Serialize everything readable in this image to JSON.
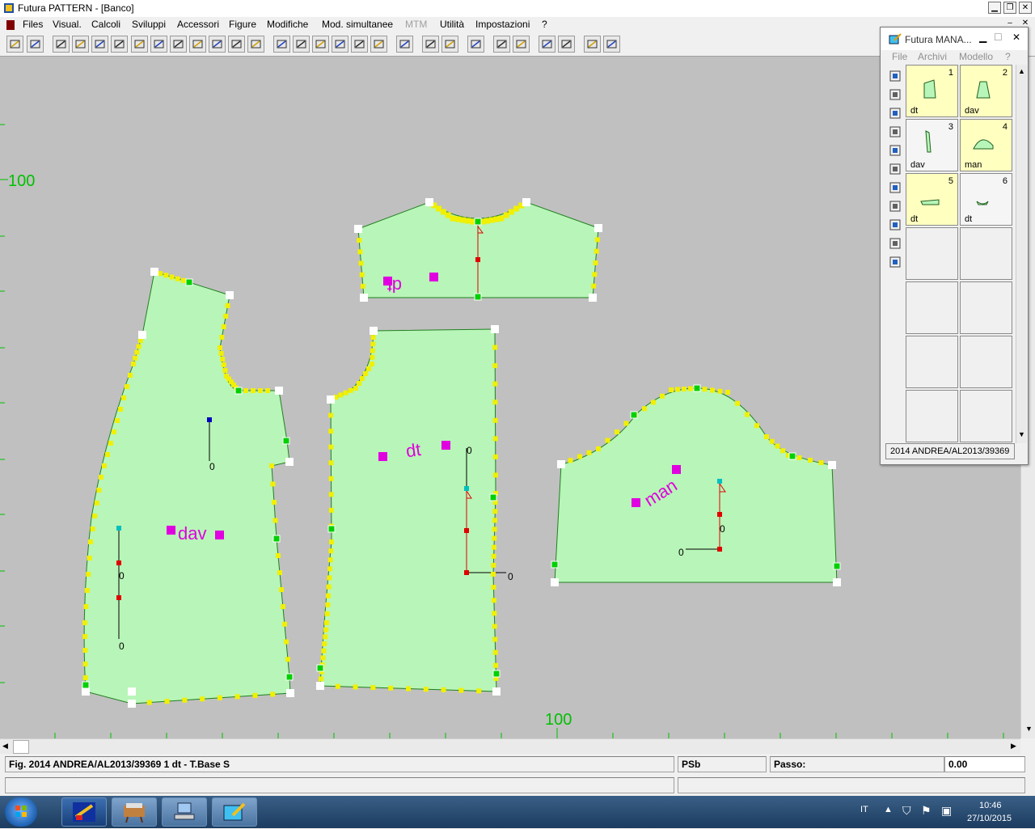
{
  "window": {
    "title": "Futura PATTERN - [Banco]"
  },
  "menu": [
    "Files",
    "Visual.",
    "Calcoli",
    "Sviluppi",
    "Accessori",
    "Figure",
    "Modifiche",
    "Mod. simultanee",
    "MTM",
    "Utilità",
    "Impostazioni",
    "?"
  ],
  "menu_disabled": [
    "MTM"
  ],
  "toolbar_icons": [
    "open-folder-icon",
    "save-icon",
    "select-icon",
    "zoom-window-icon",
    "zoom-fit-icon",
    "zoom-icon",
    "move-point-icon",
    "insert-point-icon",
    "piece-icon",
    "piece-sew-icon",
    "piece-cut-icon",
    "grid-icon",
    "dart-icon",
    "pencil-icon",
    "line-icon",
    "rectangle-icon",
    "circle-icon",
    "ellipse-icon",
    "text-box-icon",
    "undo-icon",
    "redo-icon",
    "measure-icon",
    "mirror-icon",
    "grade-icon",
    "tape-icon",
    "rotate-icon",
    "ruler-h-icon",
    "ruler-size-icon",
    "ruler-diagonal-icon"
  ],
  "canvas": {
    "ruler_labels": {
      "left": "100",
      "bottom": "100"
    },
    "pieces": [
      {
        "id": "dav",
        "label": "dav"
      },
      {
        "id": "dt_back",
        "label": "dt"
      },
      {
        "id": "dt_yoke",
        "label": "dt"
      },
      {
        "id": "man",
        "label": "man"
      }
    ],
    "axis_label": "0"
  },
  "manager": {
    "title": "Futura MANA...",
    "menu": [
      "File",
      "Archivi",
      "Modello",
      "?"
    ],
    "side_icons": [
      "new-doc-icon",
      "search-doc-icon",
      "binoculars-icon",
      "hanger-icon",
      "copy-icon",
      "print-icon",
      "export-icon",
      "layout-icon",
      "target-icon",
      "iron-icon",
      "figure-icon"
    ],
    "cells": [
      {
        "num": "1",
        "label": "dt",
        "filled": true
      },
      {
        "num": "2",
        "label": "dav",
        "filled": true
      },
      {
        "num": "3",
        "label": "dav",
        "filled": false
      },
      {
        "num": "4",
        "label": "man",
        "filled": true
      },
      {
        "num": "5",
        "label": "dt",
        "filled": true
      },
      {
        "num": "6",
        "label": "dt",
        "filled": false
      }
    ],
    "footer": "2014 ANDREA/AL2013/39369"
  },
  "status": {
    "figure": "Fig. 2014 ANDREA/AL2013/39369 1 dt - T.Base S",
    "mode": "PSb",
    "step_label": "Passo:",
    "step_value": "0.00"
  },
  "taskbar": {
    "language": "IT",
    "time": "10:46",
    "date": "27/10/2015"
  },
  "colors": {
    "canvas": "#c0c0c0",
    "piece_fill": "#b8f5b8",
    "seam_points": "#f0f000",
    "label": "#e000e0",
    "ruler": "#00c000"
  }
}
